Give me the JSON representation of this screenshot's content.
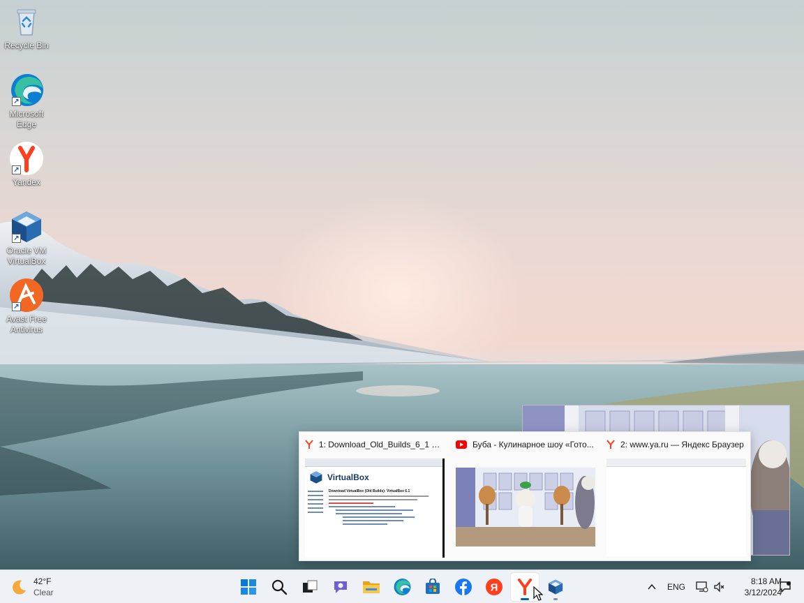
{
  "desktop": {
    "icons": [
      {
        "label": "Recycle Bin",
        "icon": "recycle-bin-icon"
      },
      {
        "label": "Microsoft Edge",
        "icon": "edge-icon"
      },
      {
        "label": "Yandex",
        "icon": "yandex-browser-icon"
      },
      {
        "label": "Oracle VM VirtualBox",
        "icon": "virtualbox-icon"
      },
      {
        "label": "Avast Free Antivirus",
        "icon": "avast-icon"
      }
    ]
  },
  "preview": {
    "thumbs": [
      {
        "title": "1: Download_Old_Builds_6_1 – ...",
        "icon": "yandex-favicon-icon",
        "page_heading": "VirtualBox",
        "page_subheading": "Download VirtualBox (Old Builds): VirtualBox 6.1"
      },
      {
        "title": "Буба - Кулинарное шоу «Гото...",
        "icon": "youtube-icon"
      },
      {
        "title": "2: www.ya.ru — Яндекс Браузер",
        "icon": "yandex-favicon-icon"
      }
    ]
  },
  "taskbar": {
    "weather": {
      "temp": "42°F",
      "condition": "Clear",
      "icon": "moon-icon"
    },
    "apps": [
      {
        "name": "Start",
        "icon": "windows-start-icon"
      },
      {
        "name": "Search",
        "icon": "search-icon"
      },
      {
        "name": "Task View",
        "icon": "task-view-icon"
      },
      {
        "name": "Teams Chat",
        "icon": "teams-chat-icon"
      },
      {
        "name": "File Explorer",
        "icon": "file-explorer-icon"
      },
      {
        "name": "Microsoft Edge",
        "icon": "edge-icon"
      },
      {
        "name": "Microsoft Store",
        "icon": "store-icon"
      },
      {
        "name": "Facebook",
        "icon": "facebook-icon"
      },
      {
        "name": "Yandex",
        "icon": "yandex-icon"
      },
      {
        "name": "Yandex Browser",
        "icon": "yandex-browser-icon"
      },
      {
        "name": "Oracle VM VirtualBox",
        "icon": "virtualbox-icon"
      }
    ],
    "tray": {
      "language": "ENG",
      "time": "8:18 AM",
      "date": "3/12/2024"
    }
  },
  "colors": {
    "taskbar_bg": "#eef1f5",
    "accent": "#005fb8",
    "yandex_red": "#fc3f1d",
    "youtube_red": "#ff0000",
    "facebook_blue": "#1877f2"
  }
}
